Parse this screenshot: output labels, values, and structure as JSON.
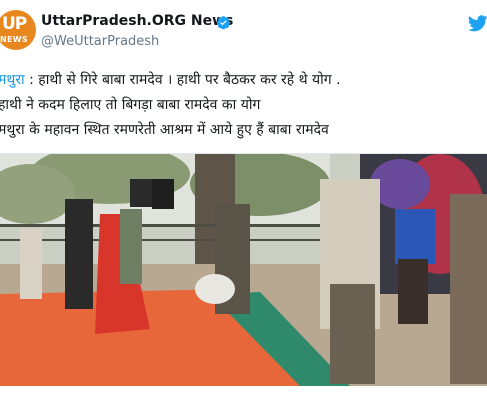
{
  "account": {
    "name": "UttarPradesh.ORG News",
    "handle": "@WeUttarPradesh",
    "avatar_logo": {
      "up": "UP",
      "news": "NEWS"
    },
    "verified": true
  },
  "tweet": {
    "lines": [
      {
        "location": "मथुरा",
        "text": " : हाथी से गिरे बाबा रामदेव । हाथी पर बैठकर कर रहे थे योग ."
      },
      {
        "location": "",
        "text": "हाथी ने कदम हिलाए तो बिगड़ा बाबा रामदेव का योग"
      },
      {
        "location": "",
        "text": "मथुरा के महावन स्थित रमणरेती आश्रम में आये हुए हैं बाबा रामदेव"
      }
    ]
  },
  "media": {
    "type": "video-still"
  },
  "colors": {
    "link": "#1b95e0",
    "verified": "#1da1f2",
    "avatar_bg": "#e8871e",
    "handle": "#657786",
    "carpet": "#e8673a",
    "mat": "#2f8a6b"
  },
  "icons": [
    "twitter-bird-icon",
    "verified-badge-icon"
  ]
}
